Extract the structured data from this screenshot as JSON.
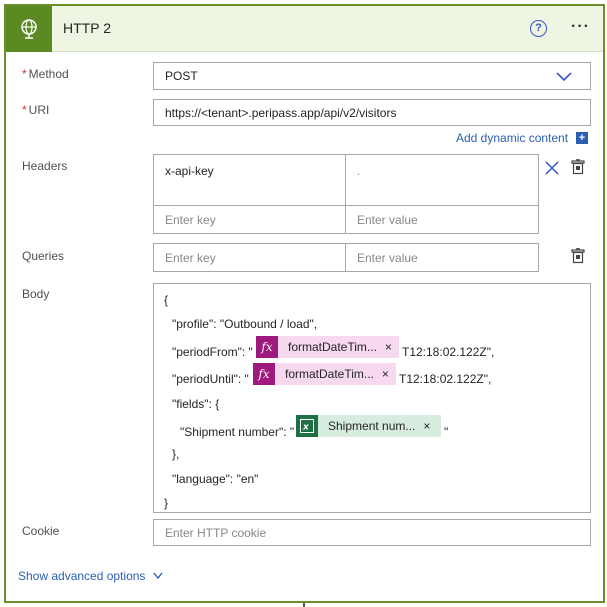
{
  "header": {
    "title": "HTTP 2",
    "help_glyph": "?",
    "more_glyph": "···",
    "icon": "globe-icon",
    "accent": "#5b8a22"
  },
  "method": {
    "label": "Method",
    "required": "*",
    "value": "POST"
  },
  "uri": {
    "label": "URI",
    "required": "*",
    "value": "https://<tenant>.peripass.app/api/v2/visitors",
    "dynamic_link": "Add dynamic content",
    "dynamic_plus": "+"
  },
  "headers": {
    "label": "Headers",
    "rows": [
      {
        "key": "x-api-key",
        "value": "."
      }
    ],
    "key_placeholder": "Enter key",
    "value_placeholder": "Enter value"
  },
  "queries": {
    "label": "Queries",
    "key_placeholder": "Enter key",
    "value_placeholder": "Enter value"
  },
  "body": {
    "label": "Body",
    "line_open": "{",
    "line_profile": "\"profile\": \"Outbound / load\",",
    "period_from_prefix": "\"periodFrom\": \"",
    "period_from_token": "formatDateTim...",
    "period_from_suffix": "T12:18:02.122Z\",",
    "period_until_prefix": "\"periodUntil\": \"",
    "period_until_token": "formatDateTim...",
    "period_until_suffix": "T12:18:02.122Z\",",
    "fields_open": "\"fields\": {",
    "shipment_prefix": "\"Shipment number\": \"",
    "shipment_token": "Shipment num...",
    "shipment_suffix": "\"",
    "fields_close": "},",
    "language": "\"language\": \"en\"",
    "line_close": "}",
    "token_close": "×",
    "fx_glyph": "fx",
    "xl_glyph": "x"
  },
  "cookie": {
    "label": "Cookie",
    "placeholder": "Enter HTTP cookie"
  },
  "advanced": {
    "label": "Show advanced options"
  }
}
